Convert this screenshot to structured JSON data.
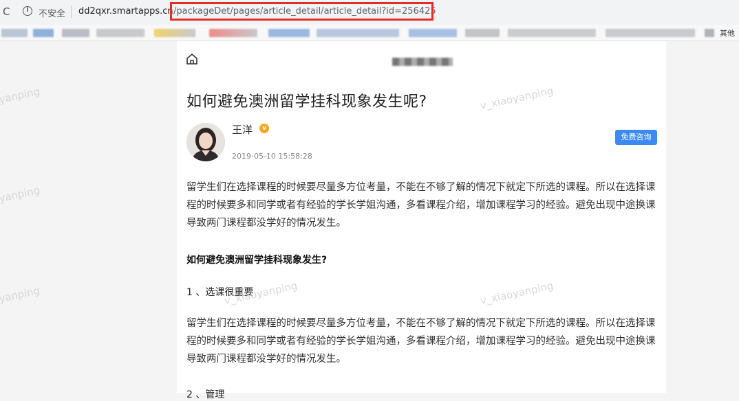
{
  "browser": {
    "security_label": "不安全",
    "url_host": "dd2qxr.smartapps.cn",
    "url_path": "/packageDet/pages/article_detail/article_detail?id=256425",
    "bookmarks_more": "其他"
  },
  "article": {
    "title": "如何避免澳洲留学挂科现象发生呢?",
    "author": "王洋",
    "date": "2019-05-10 15:58:28",
    "consult_button": "免费咨询",
    "intro": "留学生们在选择课程的时候要尽量多方位考量，不能在不够了解的情况下就定下所选的课程。所以在选择课程的时候要多和同学或者有经验的学长学姐沟通，多看课程介绍，增加课程学习的经验。避免出现中途换课导致两门课程都没学好的情况发生。",
    "section_heading": "如何避免澳洲留学挂科现象发生?",
    "point1_title": "1 、选课很重要",
    "point1_body": "留学生们在选择课程的时候要尽量多方位考量，不能在不够了解的情况下就定下所选的课程。所以在选择课程的时候要多和同学或者有经验的学长学姐沟通，多看课程介绍，增加课程学习的经验。避免出现中途换课导致两门课程都没学好的情况发生。",
    "point2_title": "2 、管理"
  },
  "watermark": {
    "text": "v_xiaoyanping",
    "text_partial": "yanping"
  },
  "colors": {
    "accent": "#3d8bf2",
    "highlight": "#e52d27",
    "verified": "#f5a623"
  }
}
